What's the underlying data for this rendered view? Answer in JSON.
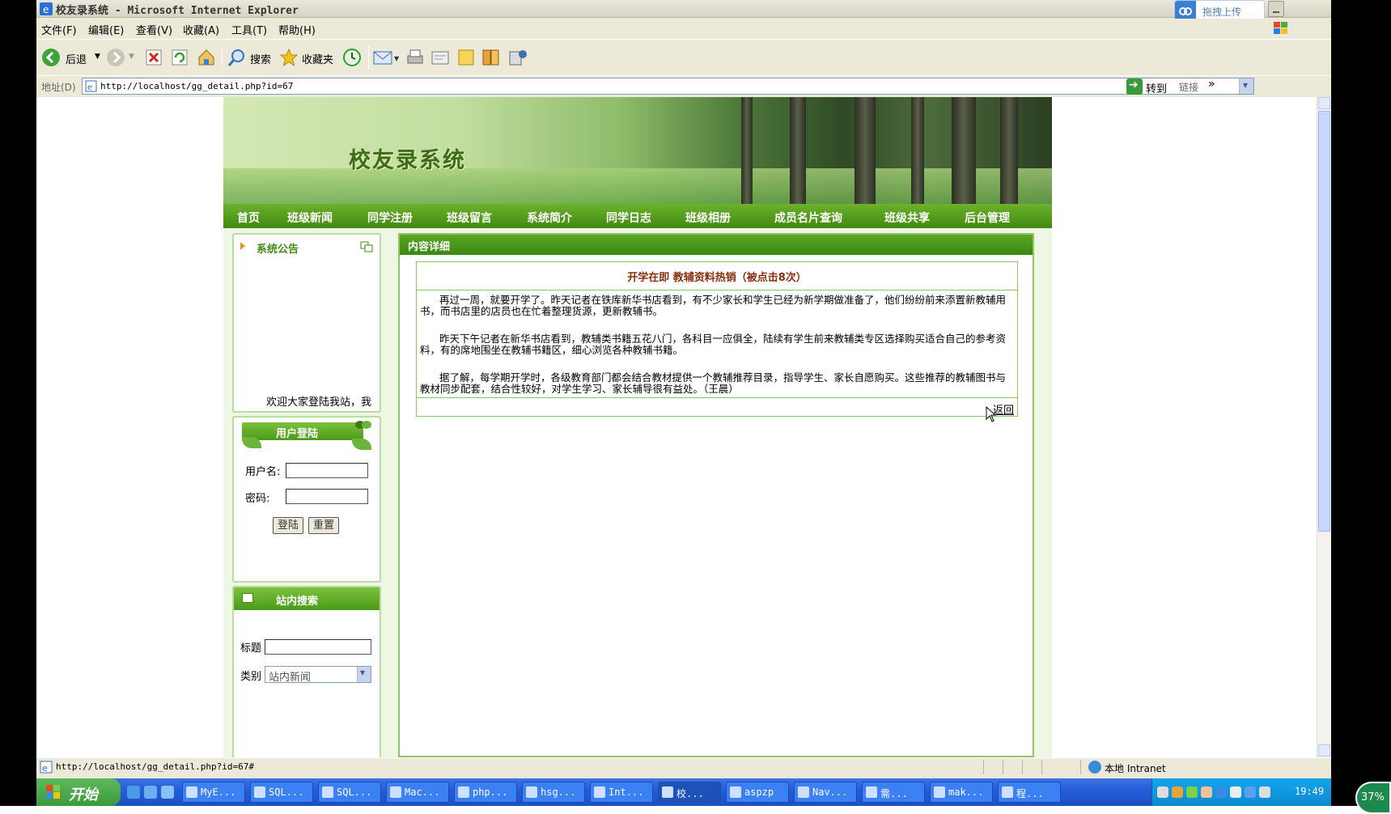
{
  "window": {
    "title": "校友录系统 - Microsoft Internet Explorer",
    "upload_label": "拖拽上传"
  },
  "menu": [
    "文件(F)",
    "编辑(E)",
    "查看(V)",
    "收藏(A)",
    "工具(T)",
    "帮助(H)"
  ],
  "toolbar": {
    "back": "后退",
    "search": "搜索",
    "favorites": "收藏夹"
  },
  "address": {
    "label": "地址(D)",
    "url": "http://localhost/gg_detail.php?id=67",
    "go": "转到",
    "links": "链接"
  },
  "site": {
    "title": "校友录系统",
    "nav": [
      "首页",
      "班级新闻",
      "同学注册",
      "班级留言",
      "系统简介",
      "同学日志",
      "班级相册",
      "成员名片查询",
      "班级共享",
      "后台管理"
    ],
    "notice": {
      "title": "系统公告",
      "scroll_text": "欢迎大家登陆我站，我"
    },
    "login": {
      "title": "用户登陆",
      "username_label": "用户名:",
      "password_label": "密码:",
      "login_btn": "登陆",
      "reset_btn": "重置"
    },
    "search": {
      "title": "站内搜索",
      "title_label": "标题",
      "type_label": "类别",
      "type_value": "站内新闻"
    },
    "content": {
      "header": "内容详细",
      "article_title": "开学在即 教辅资料热销（被点击8次）",
      "paragraphs": [
        "再过一周，就要开学了。昨天记者在铁库新华书店看到，有不少家长和学生已经为新学期做准备了，他们纷纷前来添置新教辅用书，而书店里的店员也在忙着整理货源，更新教辅书。",
        "昨天下午记者在新华书店看到，教辅类书籍五花八门，各科目一应俱全，陆续有学生前来教辅类专区选择购买适合自己的参考资料，有的席地围坐在教辅书籍区，细心浏览各种教辅书籍。",
        "据了解，每学期开学时，各级教育部门都会结合教材提供一个教辅推荐目录，指导学生、家长自愿购买。这些推荐的教辅图书与教材同步配套，结合性较好，对学生学习、家长辅导很有益处。（王晨）"
      ],
      "back_link": "返回"
    }
  },
  "statusbar": {
    "url": "http://localhost/gg_detail.php?id=67#",
    "zone": "本地 Intranet"
  },
  "taskbar": {
    "start": "开始",
    "tasks": [
      "MyE...",
      "SQL...",
      "SQL...",
      "Mac...",
      "php...",
      "hsg...",
      "Int...",
      "校...",
      "aspzp",
      "Nav...",
      "需...",
      "mak...",
      "程..."
    ],
    "clock": "19:49",
    "zoom": "37%"
  },
  "colors": {
    "nav_green": "#4b9a1a",
    "title_brown": "#8a2f0c",
    "taskbar_blue": "#245edb"
  }
}
